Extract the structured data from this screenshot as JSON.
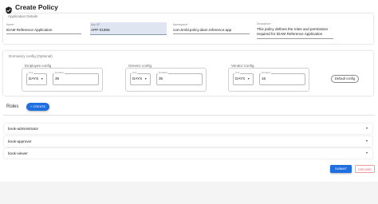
{
  "page": {
    "title": "Create Policy"
  },
  "application_details": {
    "section_label": "Application Details",
    "fields": [
      {
        "label": "Name",
        "required_mark": "*",
        "value": "IDAM Reference Application"
      },
      {
        "label": "App ID",
        "required_mark": "*",
        "value": "APP-01968"
      },
      {
        "label": "Namespace",
        "required_mark": "*",
        "value": "com.kmbl.policy.idam.reference.app"
      },
      {
        "label": "Description",
        "required_mark": "*",
        "value_line1": "This policy defines the roles and permission",
        "value_line2": "required for IDAM Reference Application"
      }
    ]
  },
  "dormancy": {
    "section_label": "Dormancy config (Optional)",
    "groups": [
      {
        "title": "Employee config",
        "unit_label": "Unit",
        "unit_value": "DAYS",
        "duration_label": "Duration",
        "duration_value": "35"
      },
      {
        "title": "Generic config",
        "unit_label": "Unit",
        "unit_value": "DAYS",
        "duration_label": "Duration",
        "duration_value": "35"
      },
      {
        "title": "Vendor Config",
        "unit_label": "Unit",
        "unit_value": "DAYS",
        "duration_label": "Duration",
        "duration_value": "15"
      }
    ],
    "default_button": "Default config"
  },
  "roles": {
    "title": "Roles",
    "create_button": "+ CREATE",
    "items": [
      {
        "label": "book-administrator"
      },
      {
        "label": "book-approver"
      },
      {
        "label": "book-viewer"
      }
    ]
  },
  "actions": {
    "submit": "SUBMIT",
    "discard": "DISCARD"
  },
  "colors": {
    "primary": "#1f6fe0",
    "discard": "#e05a5a",
    "appid_fill": "#dfe6f2"
  }
}
